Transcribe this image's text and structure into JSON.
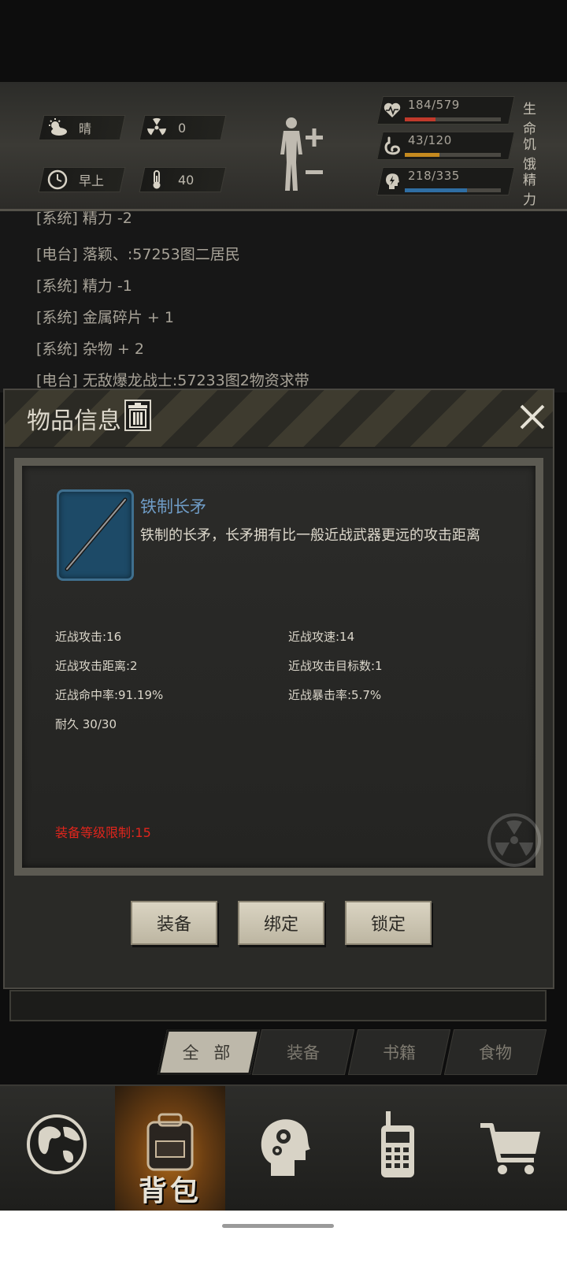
{
  "status": {
    "weather": "晴",
    "radiation": "0",
    "time_of_day": "早上",
    "temperature": "40",
    "health": {
      "text": "184/579",
      "label": "生命",
      "fraction": 0.318,
      "color": "#c0392b"
    },
    "hunger": {
      "text": "43/120",
      "label": "饥饿",
      "fraction": 0.358,
      "color": "#c58a1f"
    },
    "energy": {
      "text": "218/335",
      "label": "精力",
      "fraction": 0.651,
      "color": "#2f6ea3"
    }
  },
  "log": {
    "lines": [
      "[系统] 精力 -2",
      "[电台] 落颖、:57253图二居民",
      "[系统] 精力 -1",
      "[系统] 金属碎片 + 1",
      "[系统] 杂物 + 2",
      "[电台] 无敌爆龙战士:57233图2物资求带"
    ]
  },
  "dialog": {
    "title": "物品信息",
    "item": {
      "name": "铁制长矛",
      "description": "铁制的长矛，长矛拥有比一般近战武器更远的攻击距离",
      "icon": "spear-icon"
    },
    "attributes": [
      "近战攻击:16",
      "近战攻速:14",
      "近战攻击距离:2",
      "近战攻击目标数:1",
      "近战命中率:91.19%",
      "近战暴击率:5.7%",
      "耐久 30/30"
    ],
    "level_requirement": "装备等级限制:15",
    "buttons": {
      "equip": "装备",
      "bind": "绑定",
      "lock": "锁定"
    }
  },
  "category_tabs": [
    "全 部",
    "装备",
    "书籍",
    "食物"
  ],
  "bottom_nav": {
    "backpack_label": "背包"
  }
}
